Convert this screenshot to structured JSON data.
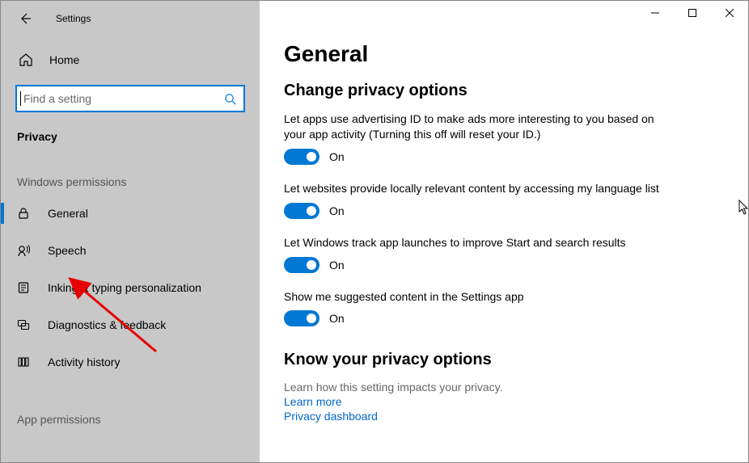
{
  "app": {
    "title": "Settings"
  },
  "sidebar": {
    "home": "Home",
    "search_placeholder": "Find a setting",
    "category": "Privacy",
    "group_windows": "Windows permissions",
    "items": [
      {
        "label": "General"
      },
      {
        "label": "Speech"
      },
      {
        "label": "Inking & typing personalization"
      },
      {
        "label": "Diagnostics & feedback"
      },
      {
        "label": "Activity history"
      }
    ],
    "group_app": "App permissions"
  },
  "page": {
    "title": "General",
    "section1": "Change privacy options",
    "settings": [
      {
        "desc": "Let apps use advertising ID to make ads more interesting to you based on your app activity (Turning this off will reset your ID.)",
        "state": "On"
      },
      {
        "desc": "Let websites provide locally relevant content by accessing my language list",
        "state": "On"
      },
      {
        "desc": "Let Windows track app launches to improve Start and search results",
        "state": "On"
      },
      {
        "desc": "Show me suggested content in the Settings app",
        "state": "On"
      }
    ],
    "section2": "Know your privacy options",
    "section2_sub": "Learn how this setting impacts your privacy.",
    "links": [
      "Learn more",
      "Privacy dashboard"
    ]
  }
}
